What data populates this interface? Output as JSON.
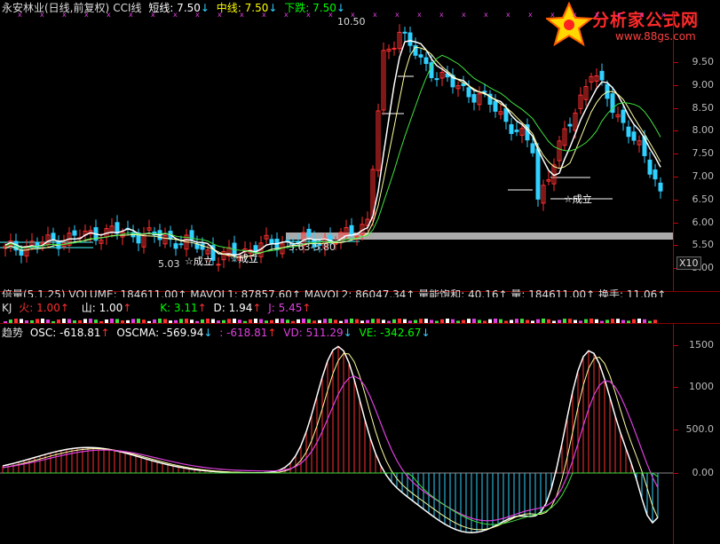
{
  "header": {
    "stock": "永安林业(日线,前复权)",
    "indicator": "CCI线",
    "short_label": "短线: 7.50",
    "short_arrow": "↓",
    "mid_label": "中线: 7.50",
    "mid_arrow": "↓",
    "fall_label": "下跌: 7.50",
    "fall_arrow": "↓"
  },
  "logo": {
    "title": "分析家公式网",
    "url": "www.88gs.com"
  },
  "price_axis": [
    "9.50",
    "9.00",
    "8.50",
    "8.00",
    "7.50",
    "7.00",
    "6.50",
    "6.00",
    "5.50",
    "5.00"
  ],
  "annotations": {
    "high": "10.50",
    "low": "5.03",
    "band": "5.63-5.80",
    "signal1": "☆成立",
    "signal2": "☆成立",
    "signal3": "☆成立"
  },
  "x10_button": "X10",
  "volume_row": "倍量(5,1.25) VOLUME: 184611.00↑ MAVOL1: 87857.60↑ MAVOL2: 86047.34↑ 量能饱和: 40.16↑ 量: 184611.00↑ 换手: 11.06↑",
  "kj_row": {
    "name": "KJ",
    "fire": "火: 1.00",
    "fire_arrow": "↑",
    "mountain": "山: 1.00",
    "mountain_arrow": "↑",
    "k": "K: 3.11",
    "k_arrow": "↑",
    "d": "D: 1.94",
    "d_arrow": "↑",
    "j": "J: 5.45",
    "j_arrow": "↑"
  },
  "osc_row": {
    "name": "趋势",
    "osc": "OSC: -618.81",
    "osc_arrow": "↑",
    "oscma": "OSCMA: -569.94",
    "oscma_arrow": "↓",
    "third": ": -618.81",
    "third_arrow": "↑",
    "vd": "VD: 511.29",
    "vd_arrow": "↓",
    "ve": "VE: -342.67",
    "ve_arrow": "↓"
  },
  "osc_axis": [
    "1500",
    "1000",
    "500.0",
    "0.00"
  ],
  "colors": {
    "up": "#ff3030",
    "down": "#30d0ff",
    "ma_white": "#ffffff",
    "ma_green": "#40e040",
    "magenta": "#e040e0",
    "axis_red": "#cc0000"
  }
}
